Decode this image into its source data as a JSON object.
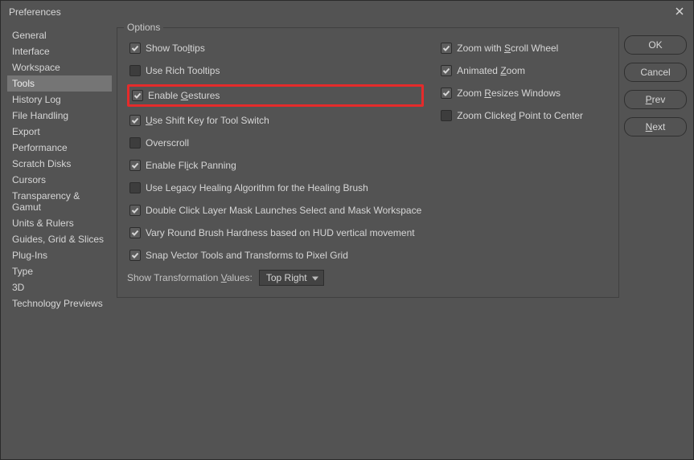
{
  "window": {
    "title": "Preferences"
  },
  "sidebar": {
    "items": [
      {
        "label": "General",
        "active": false
      },
      {
        "label": "Interface",
        "active": false
      },
      {
        "label": "Workspace",
        "active": false
      },
      {
        "label": "Tools",
        "active": true
      },
      {
        "label": "History Log",
        "active": false
      },
      {
        "label": "File Handling",
        "active": false
      },
      {
        "label": "Export",
        "active": false
      },
      {
        "label": "Performance",
        "active": false
      },
      {
        "label": "Scratch Disks",
        "active": false
      },
      {
        "label": "Cursors",
        "active": false
      },
      {
        "label": "Transparency & Gamut",
        "active": false
      },
      {
        "label": "Units & Rulers",
        "active": false
      },
      {
        "label": "Guides, Grid & Slices",
        "active": false
      },
      {
        "label": "Plug-Ins",
        "active": false
      },
      {
        "label": "Type",
        "active": false
      },
      {
        "label": "3D",
        "active": false
      },
      {
        "label": "Technology Previews",
        "active": false
      }
    ]
  },
  "options": {
    "group_label": "Options",
    "left": [
      {
        "label_html": "Show Too<u>l</u>tips",
        "checked": true,
        "highlight": false
      },
      {
        "label_html": "Use Rich Tooltips",
        "checked": false,
        "highlight": false
      },
      {
        "label_html": "Enable <u>G</u>estures",
        "checked": true,
        "highlight": true
      },
      {
        "label_html": "<u>U</u>se Shift Key for Tool Switch",
        "checked": true,
        "highlight": false
      },
      {
        "label_html": "Overscroll",
        "checked": false,
        "highlight": false
      },
      {
        "label_html": "Enable Fl<u>i</u>ck Panning",
        "checked": true,
        "highlight": false
      },
      {
        "label_html": "Use Legacy Healing Algorithm for the Healing Brush",
        "checked": false,
        "highlight": false
      },
      {
        "label_html": "Double Click Layer Mask Launches Select and Mask Workspace",
        "checked": true,
        "highlight": false
      },
      {
        "label_html": "Vary Round Brush Hardness based on HUD vertical movement",
        "checked": true,
        "highlight": false
      },
      {
        "label_html": "Snap Vector Tools and Transforms to Pixel Grid",
        "checked": true,
        "highlight": false
      }
    ],
    "right": [
      {
        "label_html": "Zoom with <u>S</u>croll Wheel",
        "checked": true
      },
      {
        "label_html": "Animated <u>Z</u>oom",
        "checked": true
      },
      {
        "label_html": "Zoom <u>R</u>esizes Windows",
        "checked": true
      },
      {
        "label_html": "Zoom Clicke<u>d</u> Point to Center",
        "checked": false
      }
    ],
    "transform_label_html": "Show Transformation <u>V</u>alues:",
    "transform_value": "Top Right"
  },
  "buttons": {
    "ok": "OK",
    "cancel": "Cancel",
    "prev_html": "<u>P</u>rev",
    "next_html": "<u>N</u>ext"
  }
}
